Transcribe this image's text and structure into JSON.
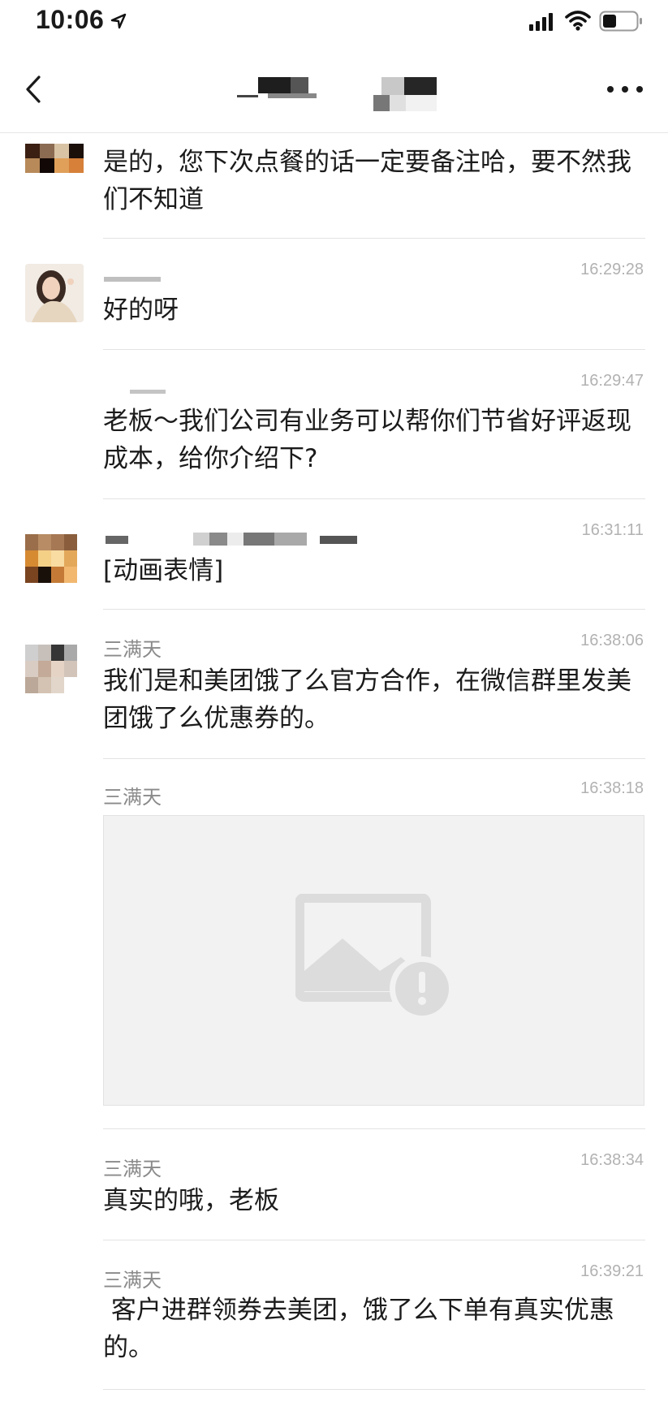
{
  "status_bar": {
    "time": "10:06"
  },
  "header": {
    "title": ""
  },
  "messages": [
    {
      "sender": "",
      "time": "",
      "text": "是的，您下次点餐的话一定要备注哈，要不然我们不知道"
    },
    {
      "sender": "",
      "time": "16:29:28",
      "text": "好的呀"
    },
    {
      "sender": "",
      "time": "16:29:47",
      "text": "老板～我们公司有业务可以帮你们节省好评返现成本，给你介绍下?"
    },
    {
      "sender": "",
      "time": "16:31:11",
      "text": "[动画表情]"
    },
    {
      "sender": "三满天",
      "time": "16:38:06",
      "text": "我们是和美团饿了么官方合作，在微信群里发美团饿了么优惠券的。"
    },
    {
      "sender": "三满天",
      "time": "16:38:18",
      "text": "",
      "image": "image-failed-icon"
    },
    {
      "sender": "三满天",
      "time": "16:38:34",
      "text": "真实的哦，老板"
    },
    {
      "sender": "三满天",
      "time": "16:39:21",
      "text": " 客户进群领券去美团，饿了么下单有真实优惠的。"
    }
  ],
  "colors": {
    "divider": "#e3e3e3",
    "timestamp": "#b2b2b2",
    "sender": "#8a8a8a",
    "placeholder_bg": "#f2f2f2",
    "placeholder_icon": "#dcdcdc"
  }
}
